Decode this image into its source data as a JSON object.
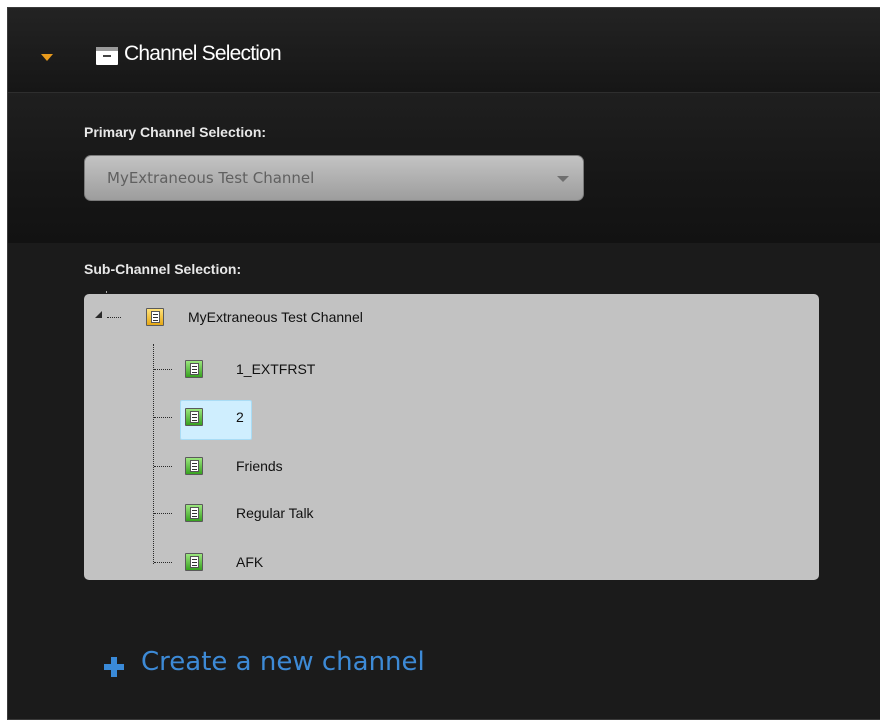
{
  "header": {
    "title": "Channel Selection",
    "arrow_color": "#e89a1c",
    "icon": "archive-box-icon"
  },
  "primary": {
    "label": "Primary Channel Selection:",
    "selected_value": "MyExtraneous Test Channel",
    "dropdown_icon": "chevron-down-icon"
  },
  "sub_channel": {
    "label": "Sub-Channel Selection:",
    "root": {
      "label": "MyExtraneous Test Channel",
      "expanded": true,
      "icon": "channel-folder-icon"
    },
    "children": [
      {
        "label": "1_EXTFRST",
        "selected": false
      },
      {
        "label": "2",
        "selected": true
      },
      {
        "label": "Friends",
        "selected": false
      },
      {
        "label": "Regular Talk",
        "selected": false
      },
      {
        "label": "AFK",
        "selected": false
      }
    ],
    "child_icon": "channel-icon",
    "selected_color": "#cfeefe"
  },
  "create": {
    "label": "Create a new channel",
    "icon": "plus-icon",
    "color": "#3d8ad6"
  }
}
